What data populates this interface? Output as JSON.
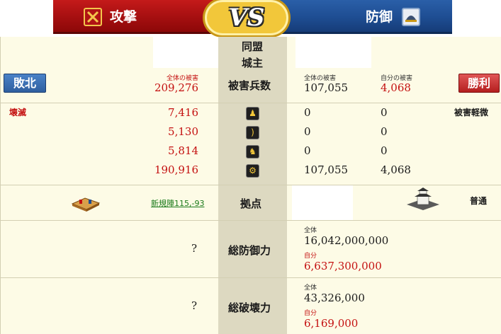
{
  "banner": {
    "attack_label": "攻撃",
    "defense_label": "防御",
    "vs_label": "VS"
  },
  "header": {
    "alliance_label": "同盟",
    "lord_label": "城主"
  },
  "casualties": {
    "row_label": "被害兵数",
    "attacker": {
      "total_caption": "全体の被害",
      "total_value": "209,276",
      "result_badge": "敗北",
      "status": "壊滅"
    },
    "defender": {
      "total_caption": "全体の被害",
      "total_value": "107,055",
      "self_caption": "自分の被害",
      "self_value": "4,068",
      "result_badge": "勝利",
      "status": "被害軽微"
    }
  },
  "units": [
    {
      "icon": "spearman-icon",
      "attacker": "7,416",
      "def_total": "0",
      "def_self": "0"
    },
    {
      "icon": "archer-icon",
      "attacker": "5,130",
      "def_total": "0",
      "def_self": "0"
    },
    {
      "icon": "cavalry-icon",
      "attacker": "5,814",
      "def_total": "0",
      "def_self": "0"
    },
    {
      "icon": "siege-icon",
      "attacker": "190,916",
      "def_total": "107,055",
      "def_self": "4,068"
    }
  ],
  "base": {
    "row_label": "拠点",
    "attacker_link": "新規陣115,-93",
    "attacker_icon": "camp-icon",
    "defender_icon": "castle-icon",
    "defender_status": "普通"
  },
  "defense_power": {
    "row_label": "総防御力",
    "attacker_value": "?",
    "total_caption": "全体",
    "total_value": "16,042,000,000",
    "self_caption": "自分",
    "self_value": "6,637,300,000"
  },
  "destruction_power": {
    "row_label": "総破壊力",
    "attacker_value": "?",
    "total_caption": "全体",
    "total_value": "43,326,000",
    "self_caption": "自分",
    "self_value": "6,169,000"
  },
  "colors": {
    "attack_red": "#a50f10",
    "defense_blue": "#1e4d92",
    "vs_gold": "#f2c73a",
    "loss_red_text": "#c41010"
  }
}
